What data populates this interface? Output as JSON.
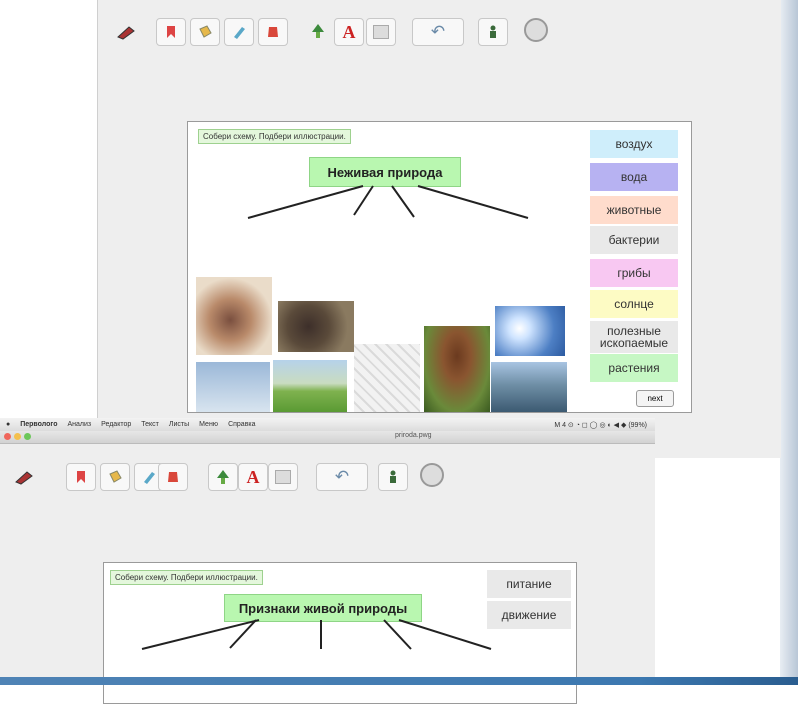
{
  "colors": {
    "window_bg": "#eeeeee",
    "hint_bg": "#e4f7dc",
    "title_bg": "#b9f7b0",
    "accent_blue": "#3c78b0"
  },
  "toolbar_icons": [
    "pen-icon",
    "bookmark-icon",
    "fill-icon",
    "brush-icon",
    "shape-icon",
    "tree-icon",
    "text-icon",
    "rectangle-icon",
    "undo-icon",
    "person-icon",
    "circle-icon"
  ],
  "screen1": {
    "hint": "Собери схему. Подбери иллюстрации.",
    "title": "Неживая природа",
    "words": [
      "воздух",
      "вода",
      "животные",
      "бактерии",
      "грибы",
      "солнце",
      "полезные ископаемые",
      "растения"
    ],
    "next_label": "next"
  },
  "menubar": {
    "items": [
      "Перволого",
      "Анализ",
      "Редактор",
      "Текст",
      "Листы",
      "Меню",
      "Справка"
    ],
    "status": "M 4  ⊙ ◔ ◻ ◯ ◎ ◐  ◀  ◆  (99%)"
  },
  "screen2": {
    "window_title": "priroda.pwg",
    "hint": "Собери схему. Подбери иллюстрации.",
    "title": "Признаки живой природы",
    "words": [
      "питание",
      "движение"
    ]
  }
}
